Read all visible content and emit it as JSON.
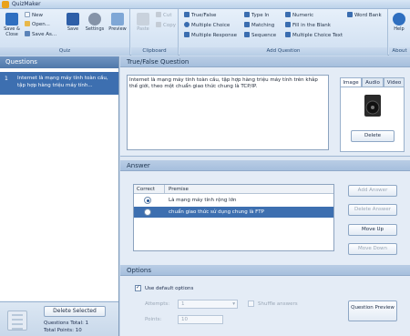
{
  "app": {
    "title": "QuizMaker"
  },
  "ribbon": {
    "quiz_group": {
      "label": "Quiz",
      "save_close": "Save & Close",
      "new": "New",
      "open": "Open...",
      "save_as": "Save As...",
      "save": "Save",
      "settings": "Settings",
      "preview": "Preview"
    },
    "clipboard_group": {
      "label": "Clipboard",
      "paste": "Paste",
      "cut": "Cut",
      "copy": "Copy"
    },
    "add_question_group": {
      "label": "Add Question",
      "true_false": "True/False",
      "multiple_choice": "Multiple Choice",
      "multiple_response": "Multiple Response",
      "type_in": "Type In",
      "matching": "Matching",
      "sequence": "Sequence",
      "numeric": "Numeric",
      "fill_in_blank": "Fill in the Blank",
      "multiple_choice_text": "Multiple Choice Text",
      "word_bank": "Word Bank"
    },
    "about_group": {
      "label": "About",
      "help": "Help"
    }
  },
  "questions_panel": {
    "header": "Questions",
    "items": [
      {
        "number": "1",
        "text": "Internet là mạng máy tính toàn cầu, tập hợp hàng triệu máy tính..."
      }
    ],
    "delete_selected": "Delete Selected",
    "questions_total": "Questions Total: 1",
    "total_points": "Total Points: 10"
  },
  "editor": {
    "header": "True/False Question",
    "question_text": "Internet là mạng máy tính toàn cầu, tập hợp hàng triệu máy tính trên khắp thế giới, theo một chuẩn giao thức chung là TCP/IP.",
    "media_tabs": [
      "Image",
      "Audio",
      "Video"
    ],
    "active_media_tab": "Image",
    "delete_media": "Delete"
  },
  "answer": {
    "header": "Answer",
    "columns": {
      "correct": "Correct",
      "premise": "Premise"
    },
    "rows": [
      {
        "correct": true,
        "premise": "Là mạng máy tính rộng lớn"
      },
      {
        "correct": false,
        "premise": "chuẩn giao thức sử dụng chung là FTP"
      }
    ],
    "add_answer": "Add Answer",
    "delete_answer": "Delete Answer",
    "move_up": "Move Up",
    "move_down": "Move Down"
  },
  "options": {
    "header": "Options",
    "use_default_options": "Use default options",
    "use_default_checked": true,
    "attempts_label": "Attempts:",
    "attempts_value": "1",
    "shuffle_answers": "Shuffle answers",
    "points_label": "Points:",
    "points_value": "10",
    "question_preview": "Question Preview"
  },
  "colors": {
    "selection_blue": "#3d6fb0",
    "panel_header_blue": "#5a80b2",
    "ribbon_light": "#dde8f5"
  }
}
